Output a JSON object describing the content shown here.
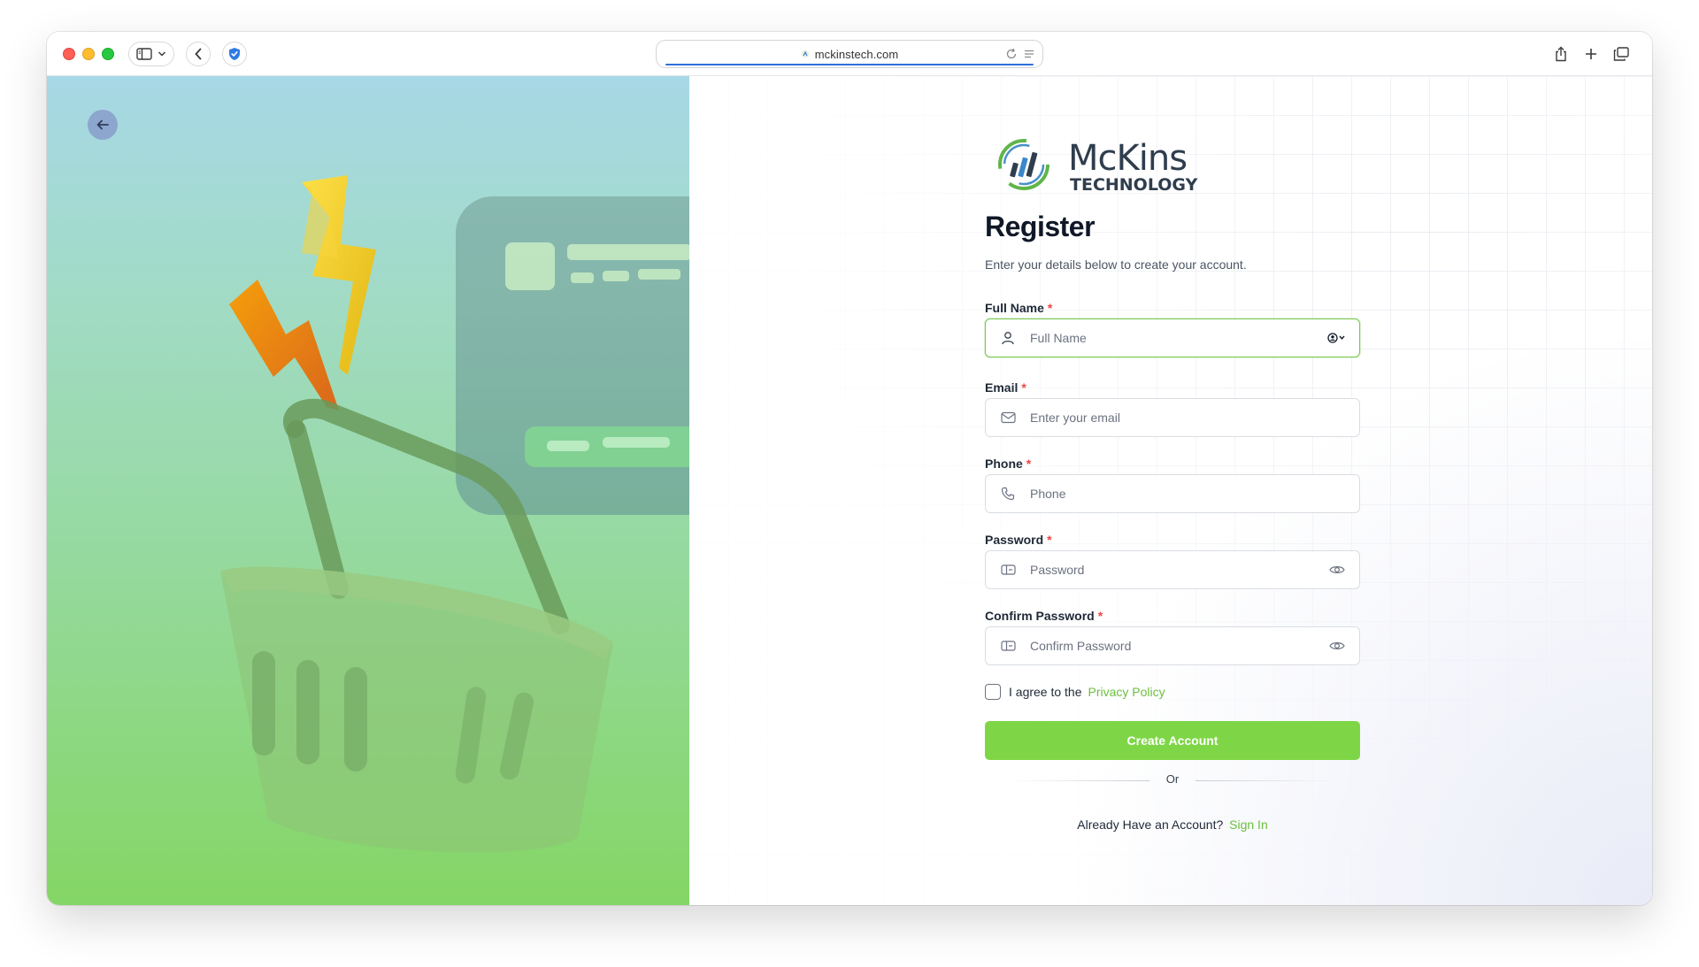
{
  "browser": {
    "url": "mckinstech.com"
  },
  "brand": {
    "name_line1": "McKins",
    "name_line2": "TECHNOLOGY",
    "accent": "#7ed646",
    "link_color": "#6cbf3f"
  },
  "register": {
    "title": "Register",
    "subtitle": "Enter your details below to create your account.",
    "fields": {
      "full_name": {
        "label": "Full Name",
        "required": "*",
        "placeholder": "Full Name",
        "value": ""
      },
      "email": {
        "label": "Email",
        "required": "*",
        "placeholder": "Enter your email",
        "value": ""
      },
      "phone": {
        "label": "Phone",
        "required": "*",
        "placeholder": "Phone",
        "value": ""
      },
      "password": {
        "label": "Password",
        "required": "*",
        "placeholder": "Password",
        "value": ""
      },
      "confirm_password": {
        "label": "Confirm Password",
        "required": "*",
        "placeholder": "Confirm Password",
        "value": ""
      }
    },
    "agree_text": "I agree to the",
    "privacy_link": "Privacy Policy",
    "agree_checked": false,
    "submit_label": "Create Account",
    "divider_text": "Or",
    "signin_prompt": "Already Have an Account?",
    "signin_link": "Sign In"
  },
  "icons": {
    "back": "arrow-left-icon",
    "person": "user-icon",
    "autofill": "contact-autofill-icon",
    "mail": "mail-icon",
    "phone": "phone-icon",
    "lock": "password-icon",
    "eye": "eye-icon"
  }
}
